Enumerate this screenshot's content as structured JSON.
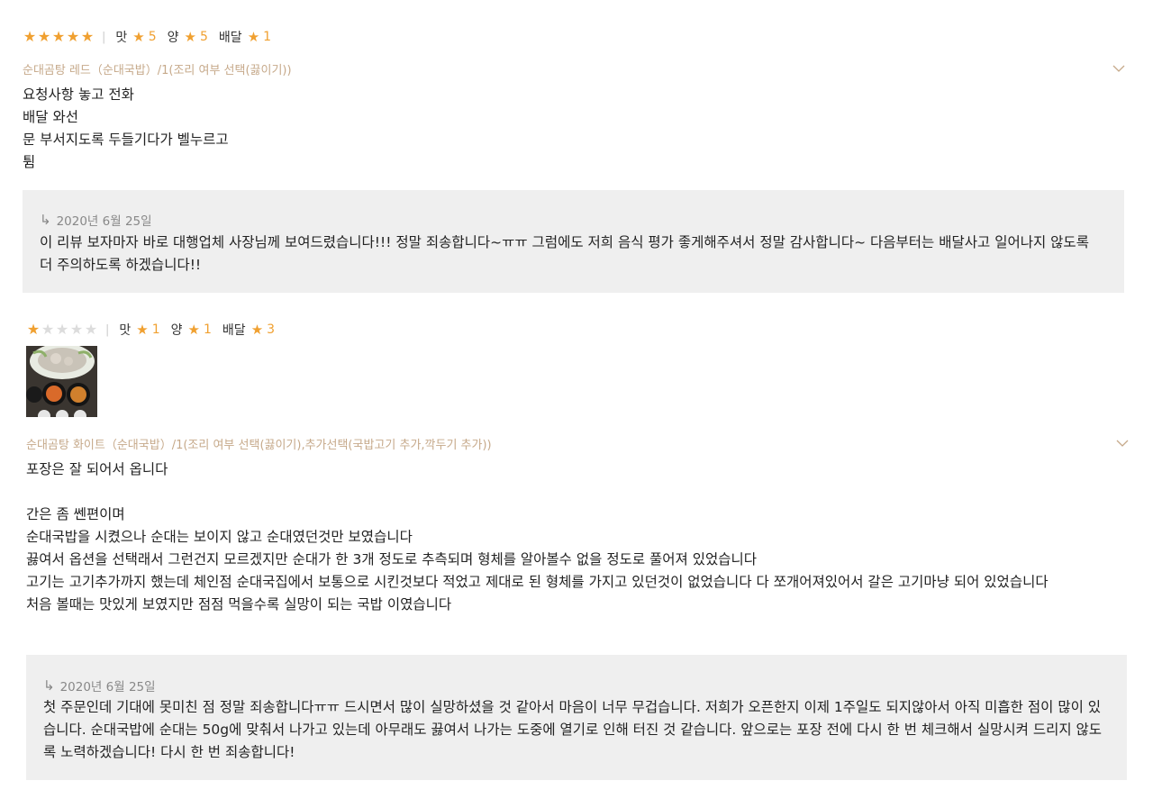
{
  "reviews": [
    {
      "stars": 5,
      "sub_ratings": [
        {
          "label": "맛",
          "star": "★",
          "value": "5"
        },
        {
          "label": "양",
          "star": "★",
          "value": "5"
        },
        {
          "label": "배달",
          "star": "★",
          "value": "1"
        }
      ],
      "menu": "순대곰탕 레드（순대국밥）/1(조리 여부 선택(끓이기))",
      "text": "요청사항 놓고 전화\n배달 와선\n문 부서지도록 두들기다가 벨누르고\n튐",
      "reply": {
        "date": "2020년 6월 25일",
        "text": "이 리뷰 보자마자 바로 대행업체 사장님께 보여드렸습니다!!! 정말 죄송합니다~ㅠㅠ 그럼에도 저희 음식 평가 좋게해주셔서 정말 감사합니다~ 다음부터는 배달사고 일어나지 않도록 더 주의하도록 하겠습니다!!"
      }
    },
    {
      "stars": 1,
      "sub_ratings": [
        {
          "label": "맛",
          "star": "★",
          "value": "1"
        },
        {
          "label": "양",
          "star": "★",
          "value": "1"
        },
        {
          "label": "배달",
          "star": "★",
          "value": "3"
        }
      ],
      "has_photo": true,
      "menu": "순대곰탕 화이트（순대국밥）/1(조리 여부 선택(끓이기),추가선택(국밥고기 추가,깍두기 추가))",
      "text": "포장은 잘 되어서 옵니다\n\n간은 좀 쎈편이며\n순대국밥을 시켰으나 순대는 보이지 않고 순대였던것만 보였습니다\n끓여서 옵션을 선택래서 그런건지 모르겠지만 순대가 한 3개 정도로 추측되며 형체를 알아볼수 없을 정도로 풀어져 있었습니다\n고기는 고기추가까지 했는데 체인점 순대국집에서 보통으로 시킨것보다 적었고 제대로 된 형체를 가지고 있던것이 없었습니다 다 쪼개어져있어서 갈은 고기마냥 되어 있었습니다\n처음 볼때는 맛있게 보였지만 점점 먹을수록 실망이 되는 국밥 이였습니다",
      "reply": {
        "date": "2020년 6월 25일",
        "text": "첫 주문인데 기대에 못미친 점 정말 죄송합니다ㅠㅠ 드시면서 많이 실망하셨을 것 같아서 마음이 너무 무겁습니다. 저희가 오픈한지 이제 1주일도 되지않아서 아직 미흡한 점이 많이 있습니다. 순대국밥에 순대는 50g에 맞춰서 나가고 있는데 아무래도 끓여서 나가는 도중에 열기로 인해 터진 것 같습니다. 앞으로는 포장 전에 다시 한 번 체크해서 실망시켜 드리지 않도록 노력하겠습니다! 다시 한 번 죄송합니다!"
      }
    }
  ],
  "colors": {
    "star_on": "#f0a030",
    "star_off": "#dcdcdc",
    "menu": "#c6a98a",
    "reply_bg": "#efefef"
  },
  "icons": {
    "expand": "chevron-down-icon",
    "reply": "reply-arrow-icon",
    "photo": "food-photo-thumbnail"
  }
}
